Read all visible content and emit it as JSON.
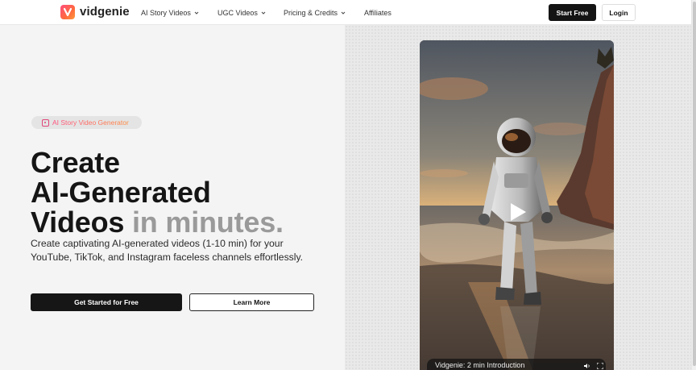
{
  "header": {
    "brand": "vidgenie",
    "nav": [
      {
        "label": "AI Story Videos",
        "dropdown": true
      },
      {
        "label": "UGC Videos",
        "dropdown": true
      },
      {
        "label": "Pricing & Credits",
        "dropdown": true
      },
      {
        "label": "Affiliates",
        "dropdown": false
      }
    ],
    "start_free": "Start Free",
    "login": "Login"
  },
  "hero": {
    "badge": "AI Story Video Generator",
    "title_line1": "Create",
    "title_line2": "AI-Generated",
    "title_line3_dark": "Videos",
    "title_line3_muted": "in minutes.",
    "subtitle": "Create captivating AI-generated videos (1-10 min) for your YouTube, TikTok, and Instagram faceless channels effortlessly.",
    "cta_primary": "Get Started for Free",
    "cta_secondary": "Learn More"
  },
  "video": {
    "caption": "Vidgenie: 2 min Introduction",
    "icons": [
      "play-icon",
      "volume-icon",
      "fullscreen-icon"
    ]
  },
  "colors": {
    "brand_gradient_start": "#ff4d7e",
    "brand_gradient_end": "#ff8a3d",
    "primary_button": "#161616",
    "muted_text": "#9a9a9a"
  }
}
